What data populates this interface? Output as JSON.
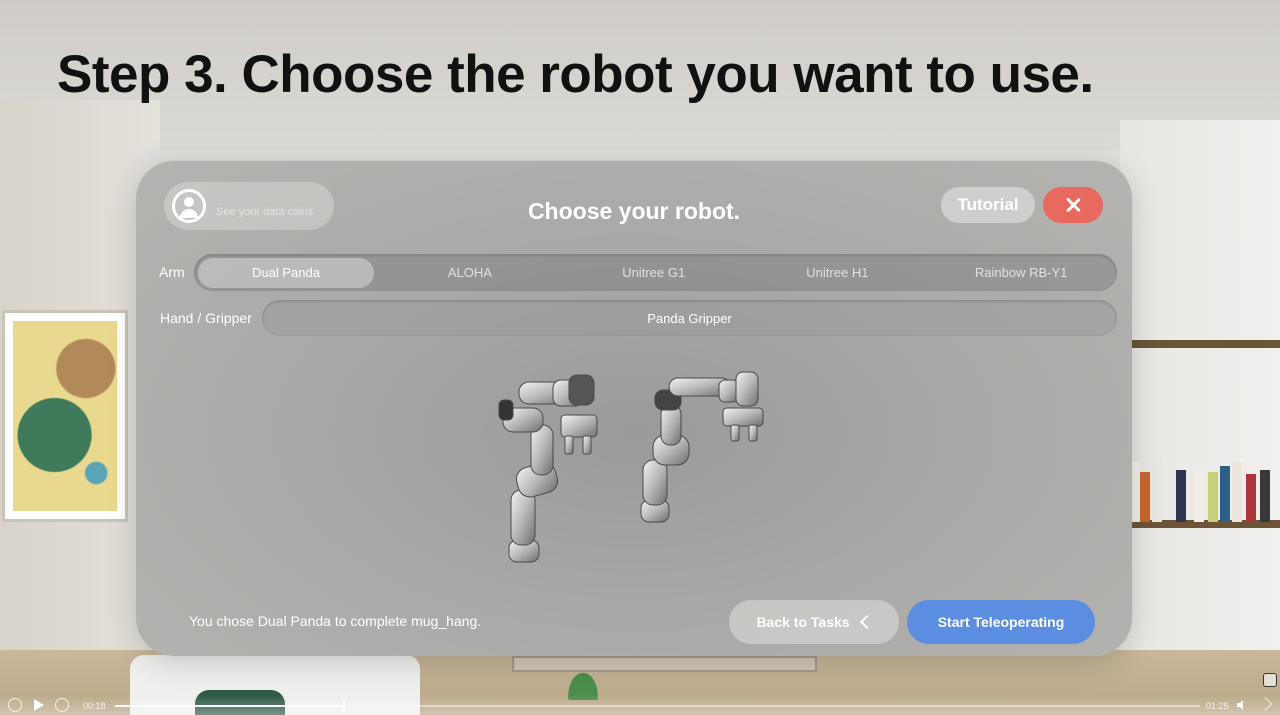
{
  "heading": "Step 3. Choose the robot you want to use.",
  "panel": {
    "title": "Choose your robot.",
    "coins_label": "See your data coins",
    "tutorial_label": "Tutorial",
    "close_icon": "close-icon",
    "arm_label": "Arm",
    "arm_options": [
      "Dual Panda",
      "ALOHA",
      "Unitree G1",
      "Unitree H1",
      "Rainbow RB-Y1"
    ],
    "selected_arm": "Dual Panda",
    "hand_label": "Hand / Gripper",
    "gripper_options": [
      "Panda Gripper"
    ],
    "selected_gripper": "Panda Gripper",
    "footer_text": "You chose Dual Panda to complete mug_hang.",
    "back_label": "Back to Tasks",
    "start_label": "Start Teleoperating"
  },
  "video": {
    "current_time": "00:18",
    "total_time": "01:25",
    "progress": 0.21
  },
  "colors": {
    "close_button": "#e8695d",
    "start_button": "#5b8ee0",
    "heading_text": "#111111"
  }
}
